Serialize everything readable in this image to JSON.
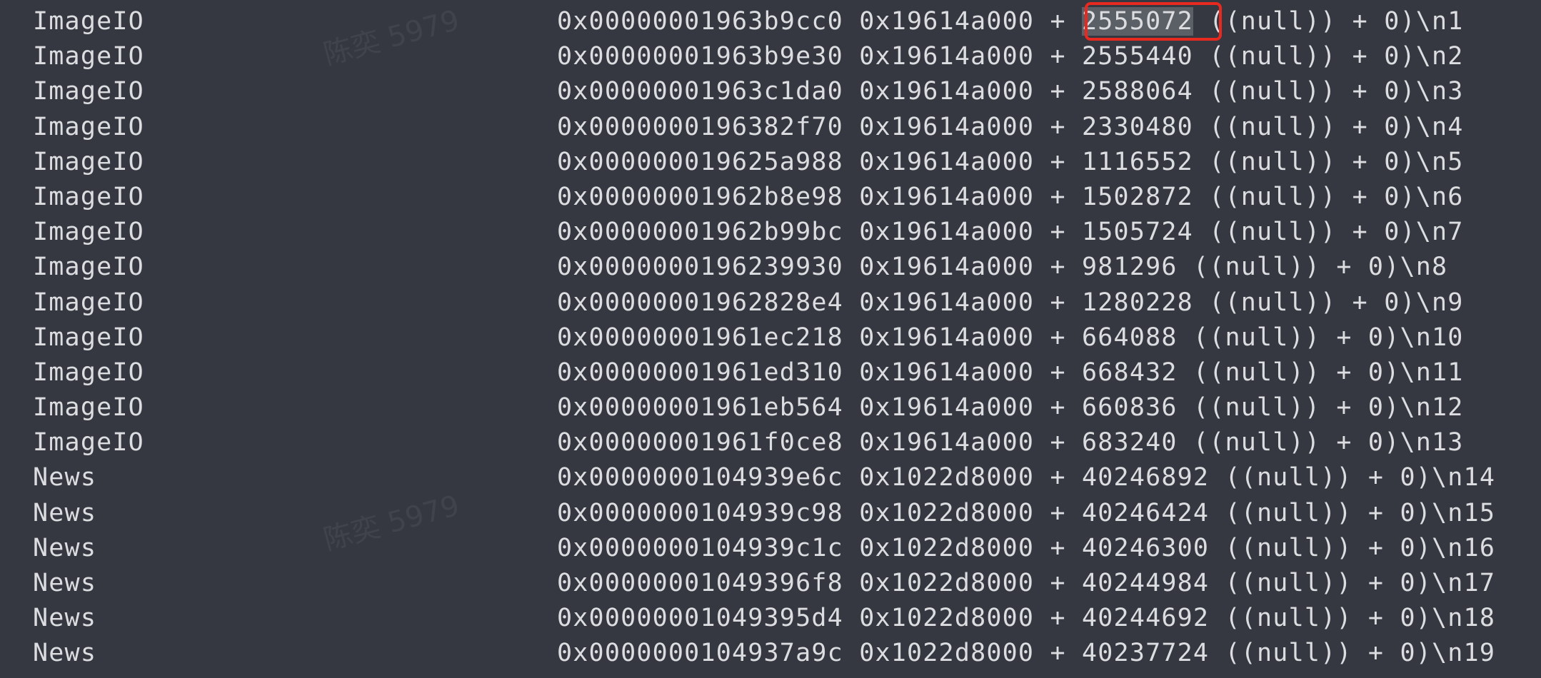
{
  "watermark": "陈奕 5979",
  "highlight_color": "#e8291f",
  "frames": [
    {
      "lib": "ImageIO",
      "addr": "0x00000001963b9cc0",
      "base": "0x19614a000",
      "offset": "2555072",
      "suffix": "((null)) + 0)\\n1",
      "highlighted": true
    },
    {
      "lib": "ImageIO",
      "addr": "0x00000001963b9e30",
      "base": "0x19614a000",
      "offset": "2555440",
      "suffix": "((null)) + 0)\\n2"
    },
    {
      "lib": "ImageIO",
      "addr": "0x00000001963c1da0",
      "base": "0x19614a000",
      "offset": "2588064",
      "suffix": "((null)) + 0)\\n3"
    },
    {
      "lib": "ImageIO",
      "addr": "0x0000000196382f70",
      "base": "0x19614a000",
      "offset": "2330480",
      "suffix": "((null)) + 0)\\n4"
    },
    {
      "lib": "ImageIO",
      "addr": "0x000000019625a988",
      "base": "0x19614a000",
      "offset": "1116552",
      "suffix": "((null)) + 0)\\n5"
    },
    {
      "lib": "ImageIO",
      "addr": "0x00000001962b8e98",
      "base": "0x19614a000",
      "offset": "1502872",
      "suffix": "((null)) + 0)\\n6"
    },
    {
      "lib": "ImageIO",
      "addr": "0x00000001962b99bc",
      "base": "0x19614a000",
      "offset": "1505724",
      "suffix": "((null)) + 0)\\n7"
    },
    {
      "lib": "ImageIO",
      "addr": "0x0000000196239930",
      "base": "0x19614a000",
      "offset": "981296",
      "suffix": "((null)) + 0)\\n8"
    },
    {
      "lib": "ImageIO",
      "addr": "0x00000001962828e4",
      "base": "0x19614a000",
      "offset": "1280228",
      "suffix": "((null)) + 0)\\n9"
    },
    {
      "lib": "ImageIO",
      "addr": "0x00000001961ec218",
      "base": "0x19614a000",
      "offset": "664088",
      "suffix": "((null)) + 0)\\n10"
    },
    {
      "lib": "ImageIO",
      "addr": "0x00000001961ed310",
      "base": "0x19614a000",
      "offset": "668432",
      "suffix": "((null)) + 0)\\n11"
    },
    {
      "lib": "ImageIO",
      "addr": "0x00000001961eb564",
      "base": "0x19614a000",
      "offset": "660836",
      "suffix": "((null)) + 0)\\n12"
    },
    {
      "lib": "ImageIO",
      "addr": "0x00000001961f0ce8",
      "base": "0x19614a000",
      "offset": "683240",
      "suffix": "((null)) + 0)\\n13"
    },
    {
      "lib": "News",
      "addr": "0x0000000104939e6c",
      "base": "0x1022d8000",
      "offset": "40246892",
      "suffix": "((null)) + 0)\\n14"
    },
    {
      "lib": "News",
      "addr": "0x0000000104939c98",
      "base": "0x1022d8000",
      "offset": "40246424",
      "suffix": "((null)) + 0)\\n15"
    },
    {
      "lib": "News",
      "addr": "0x0000000104939c1c",
      "base": "0x1022d8000",
      "offset": "40246300",
      "suffix": "((null)) + 0)\\n16"
    },
    {
      "lib": "News",
      "addr": "0x00000001049396f8",
      "base": "0x1022d8000",
      "offset": "40244984",
      "suffix": "((null)) + 0)\\n17"
    },
    {
      "lib": "News",
      "addr": "0x00000001049395d4",
      "base": "0x1022d8000",
      "offset": "40244692",
      "suffix": "((null)) + 0)\\n18"
    },
    {
      "lib": "News",
      "addr": "0x0000000104937a9c",
      "base": "0x1022d8000",
      "offset": "40237724",
      "suffix": "((null)) + 0)\\n19"
    }
  ]
}
